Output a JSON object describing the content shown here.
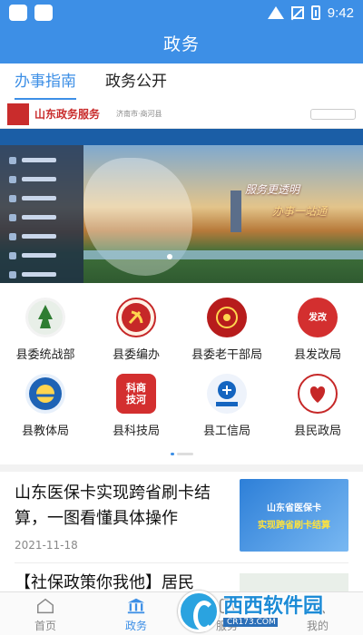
{
  "status_bar": {
    "time": "9:42"
  },
  "header": {
    "title": "政务"
  },
  "tabs": [
    {
      "label": "办事指南",
      "active": true
    },
    {
      "label": "政务公开",
      "active": false
    }
  ],
  "banner": {
    "site_name": "山东政务服务",
    "location": "济南市·商河县",
    "slogan_line1": "服务更透明",
    "slogan_line2": "办事一站通"
  },
  "departments": [
    {
      "label": "县委统战部",
      "icon": "united-front-icon",
      "color": "#2e7d32"
    },
    {
      "label": "县委编办",
      "icon": "party-emblem-icon",
      "color": "#c62828"
    },
    {
      "label": "县委老干部局",
      "icon": "veteran-cadres-icon",
      "color": "#b71c1c"
    },
    {
      "label": "县发改局",
      "icon": "development-reform-icon",
      "color": "#d32f2f",
      "text": "发改"
    },
    {
      "label": "县教体局",
      "icon": "education-sports-icon",
      "color": "#1e63b5"
    },
    {
      "label": "县科技局",
      "icon": "science-tech-icon",
      "color": "#d32f2f",
      "text": "科商技河"
    },
    {
      "label": "县工信局",
      "icon": "industry-info-icon",
      "color": "#1565c0"
    },
    {
      "label": "县民政局",
      "icon": "civil-affairs-icon",
      "color": "#c62828"
    }
  ],
  "news": [
    {
      "title": "山东医保卡实现跨省刷卡结算，一图看懂具体操作",
      "date": "2021-11-18",
      "thumb_line1": "山东省医保卡",
      "thumb_line2": "实现跨省刷卡结算"
    },
    {
      "title": "【社保政策你我他】居民"
    }
  ],
  "bottom_nav": [
    {
      "label": "首页",
      "icon": "home-icon",
      "active": false
    },
    {
      "label": "政务",
      "icon": "government-building-icon",
      "active": true
    },
    {
      "label": "服务",
      "icon": "service-icon",
      "active": false
    },
    {
      "label": "我的",
      "icon": "user-icon",
      "active": false
    }
  ],
  "watermark": {
    "main": "西西软件园",
    "sub": "CR173.COM"
  },
  "colors": {
    "primary": "#3d8fe6",
    "active_tab": "#3d8fe6"
  }
}
